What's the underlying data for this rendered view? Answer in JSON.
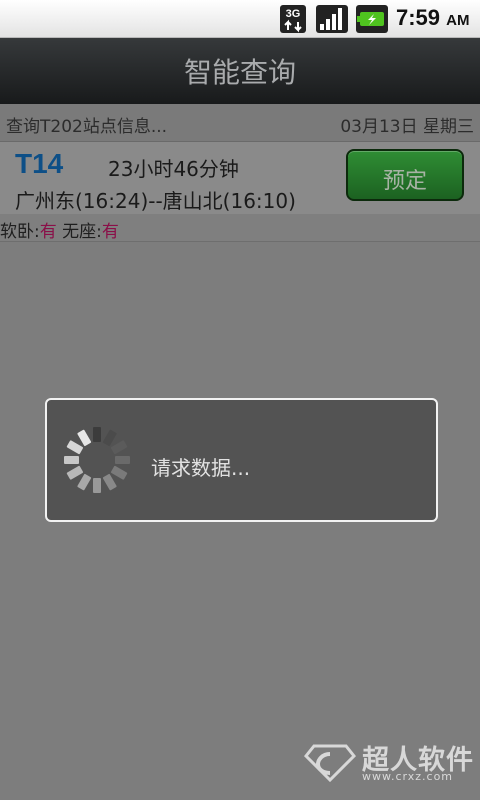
{
  "status_bar": {
    "network_type": "3G",
    "time": "7:59",
    "ampm": "AM",
    "icons": [
      "3g-data-icon",
      "signal-strength-icon",
      "battery-charging-icon"
    ],
    "battery_color": "#4fc31f"
  },
  "app_bar": {
    "title": "智能查询"
  },
  "query_bar": {
    "left_text": "查询T202站点信息...",
    "right_text": "03月13日 星期三"
  },
  "train": {
    "number": "T14",
    "duration": "23小时46分钟",
    "route": "广州东(16:24)--唐山北(16:10)",
    "book_label": "预定",
    "seats": [
      {
        "label": "软卧:",
        "status": "有"
      },
      {
        "label": "无座:",
        "status": "有"
      }
    ]
  },
  "loading_dialog": {
    "message": "请求数据..."
  },
  "watermark": {
    "brand": "超人软件",
    "url": "www.crxz.com"
  },
  "colors": {
    "train_number": "#0d4f87",
    "available": "#8a0f48",
    "book_button": "#2a7e2f"
  }
}
